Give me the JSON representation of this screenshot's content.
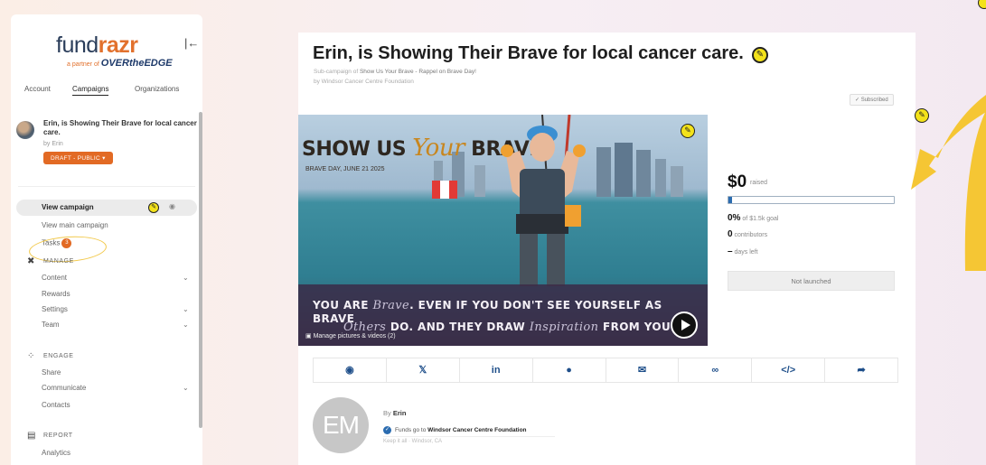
{
  "brand": {
    "name_part1": "fund",
    "name_part2": "razr",
    "partner_prefix": "a partner of",
    "partner_name": "OVERtheEDGE"
  },
  "sidebar": {
    "tabs": [
      "Account",
      "Campaigns",
      "Organizations"
    ],
    "active_tab": "Campaigns",
    "campaign": {
      "title": "Erin, is Showing Their Brave for local cancer care.",
      "by": "by Erin",
      "status": "DRAFT - PUBLIC"
    },
    "nav": {
      "view_campaign": "View campaign",
      "view_main": "View main campaign",
      "tasks": "Tasks",
      "tasks_count": "3"
    },
    "sections": {
      "manage": {
        "title": "MANAGE",
        "items": [
          "Content",
          "Rewards",
          "Settings",
          "Team"
        ]
      },
      "engage": {
        "title": "ENGAGE",
        "items": [
          "Share",
          "Communicate",
          "Contacts"
        ]
      },
      "report": {
        "title": "REPORT",
        "items": [
          "Analytics"
        ]
      }
    }
  },
  "campaign": {
    "title": "Erin, is Showing Their Brave for local cancer care.",
    "sub_prefix": "Sub-campaign of",
    "parent": "Show Us Your Brave - Rappel on Brave Day!",
    "by_org": "by Windsor Cancer Centre Foundation",
    "subscribed": "Subscribed"
  },
  "hero": {
    "headline_a": "SHOW US",
    "headline_script": "Your",
    "headline_b": "BRAVE",
    "date": "BRAVE DAY, JUNE 21 2025",
    "line1_a": "YOU ARE",
    "line1_script": "Brave",
    "line1_b": ". EVEN IF YOU DON'T SEE YOURSELF AS BRAVE",
    "line2_script": "Others",
    "line2_a": "DO. AND THEY DRAW",
    "line2_script2": "Inspiration",
    "line2_b": "FROM YOU.",
    "manage_pictures": "Manage pictures & videos (2)"
  },
  "stats": {
    "raised": "$0",
    "raised_label": "raised",
    "progress_fraction": 0.02,
    "percent": "0%",
    "goal_text": "of $1.5k goal",
    "contributors": "0",
    "contributors_label": "contributors",
    "days": "–",
    "days_label": "days left",
    "launch_button": "Not launched"
  },
  "share": {
    "icons": [
      "facebook-icon",
      "x-icon",
      "linkedin-icon",
      "messenger-icon",
      "email-icon",
      "link-icon",
      "embed-icon",
      "share-icon"
    ]
  },
  "owner": {
    "initials": "EM",
    "by_prefix": "By",
    "name": "Erin",
    "funds_prefix": "Funds go to",
    "funds_org": "Windsor Cancer Centre Foundation",
    "keep": "Keep it all · Windsor, CA"
  },
  "colors": {
    "accent_orange": "#e26a24",
    "edit_yellow": "#f3e21a",
    "arrow_yellow": "#f5c634",
    "link_blue": "#1f4f8a"
  }
}
